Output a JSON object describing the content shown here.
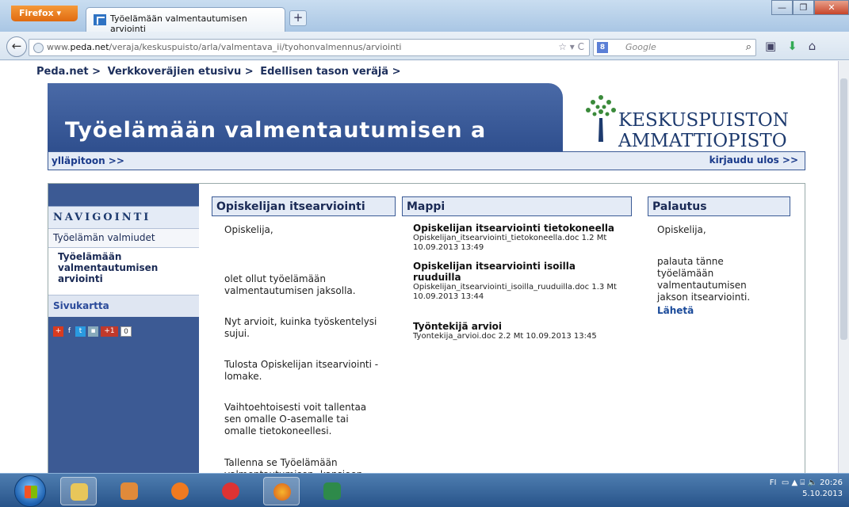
{
  "browser": {
    "menu_label": "Firefox ▾",
    "tab_title": "Työelämään valmentautumisen arviointi",
    "new_tab": "+",
    "url_prefix": "www.",
    "url_host": "peda.net",
    "url_path": "/veraja/keskuspuisto/arla/valmentava_ii/tyohonvalmennus/arviointi",
    "url_tools": "☆ ▾ C",
    "search_placeholder": "Google",
    "search_engine_badge": "8",
    "window_min": "—",
    "window_max": "❐",
    "window_close": "✕"
  },
  "breadcrumb": [
    "Peda.net >",
    "Verkkoveräjien etusivu >",
    "Edellisen tason veräjä >"
  ],
  "header": {
    "title": "Työelämään valmentautumisen a",
    "logo_line1": "KESKUSPUISTON",
    "logo_line2": "AMMATTIOPISTO"
  },
  "adminbar": {
    "left": "ylläpitoon >>",
    "right": "kirjaudu ulos >>"
  },
  "sidebar": {
    "heading": "NAVIGOINTI",
    "items": [
      "Työelämän valmiudet",
      "Työelämään valmentautumisen arviointi",
      "Sivukartta"
    ],
    "share_count": "0",
    "gplus": "+1"
  },
  "col1": {
    "heading": "Opiskelijan itsearviointi",
    "paragraphs": [
      "Opiskelija,",
      "olet ollut työelämään valmentautumisen jaksolla.",
      "Nyt arvioit, kuinka työskentelysi sujui.",
      "Tulosta Opiskelijan itsearviointi -lomake.",
      "Vaihtoehtoisesti voit tallentaa sen omalle O-asemalle tai omalle tietokoneellesi.",
      "Tallenna se Työelämään valmentautumisen -kansioon"
    ]
  },
  "col2": {
    "heading": "Mappi",
    "files": [
      {
        "title": "Opiskelijan itsearviointi tietokoneella",
        "meta": "Opiskelijan_itsearviointi_tietokoneella.doc 1.2 Mt 10.09.2013 13:49"
      },
      {
        "title": "Opiskelijan itsearviointi isoilla ruuduilla",
        "meta": "Opiskelijan_itsearviointi_isoilla_ruuduilla.doc 1.3 Mt 10.09.2013 13:44"
      },
      {
        "title": "Työntekijä arvioi",
        "meta": "Tyontekija_arvioi.doc 2.2 Mt 10.09.2013 13:45"
      }
    ]
  },
  "col3": {
    "heading": "Palautus",
    "p1": "Opiskelija,",
    "p2": "palauta tänne työelämään valmentautumisen jakson itsearviointi.",
    "link": "Lähetä"
  },
  "taskbar": {
    "tray_lang": "FI",
    "time": "20:26",
    "date": "5.10.2013"
  }
}
